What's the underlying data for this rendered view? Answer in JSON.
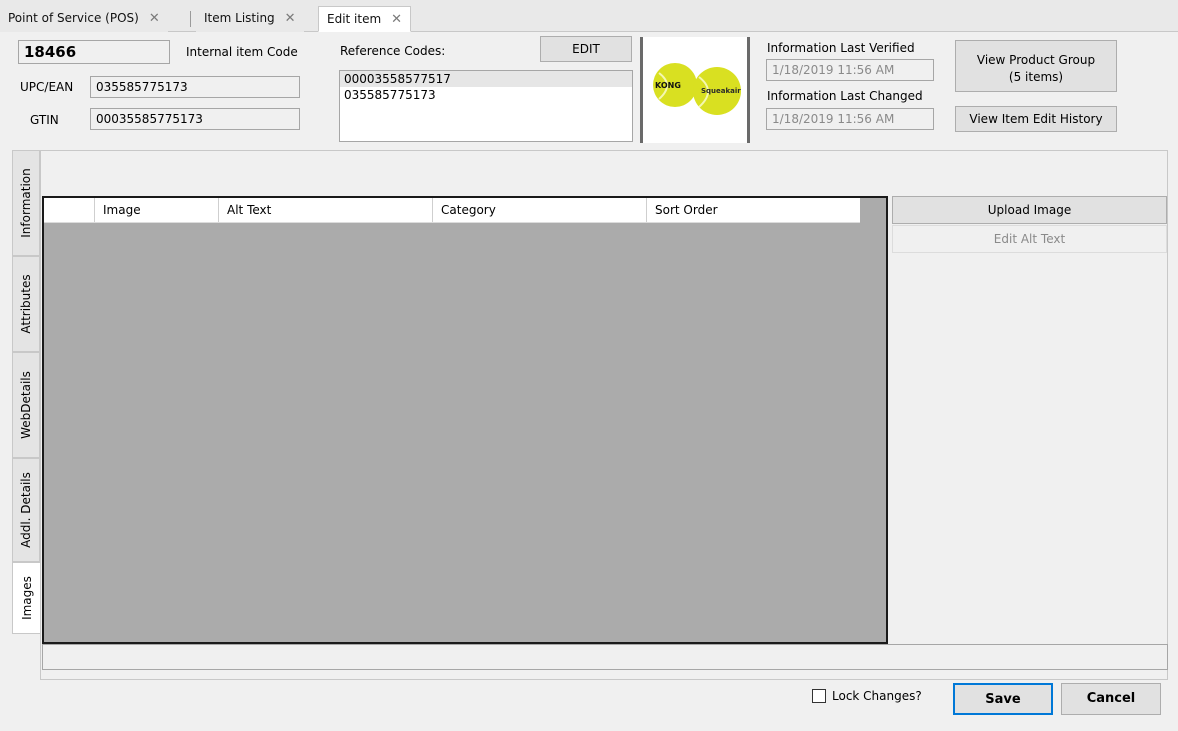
{
  "tabs": [
    {
      "label": "Point of Service (POS)",
      "close": "✕"
    },
    {
      "label": "Item Listing",
      "close": "✕"
    },
    {
      "label": "Edit item",
      "close": "✕"
    }
  ],
  "header": {
    "item_code": "18466",
    "internal_item_code_label": "Internal item Code",
    "upc_label": "UPC/EAN",
    "upc_value": "035585775173",
    "gtin_label": "GTIN",
    "gtin_value": "00035585775173",
    "reference_codes_label": "Reference Codes:",
    "edit_button": "EDIT",
    "reference_codes": [
      "00003558577517",
      "035585775173"
    ],
    "image_logo_text": "KONG",
    "image_logo_text2": "Squeakair",
    "info_last_verified_label": "Information Last Verified",
    "info_last_verified_value": "1/18/2019 11:56 AM",
    "info_last_changed_label": "Information Last Changed",
    "info_last_changed_value": "1/18/2019 11:56 AM",
    "view_product_group_line1": "View Product Group",
    "view_product_group_line2": "(5 items)",
    "view_edit_history": "View Item Edit History"
  },
  "side_tabs": [
    "Information",
    "Attributes",
    "WebDetails",
    "Addl. Details",
    "Images"
  ],
  "active_side_tab": "Images",
  "grid": {
    "columns": [
      "Image",
      "Alt Text",
      "Category",
      "Sort Order"
    ]
  },
  "actions": {
    "upload_image": "Upload Image",
    "edit_alt_text": "Edit Alt Text"
  },
  "footer": {
    "lock_changes": "Lock Changes?",
    "save": "Save",
    "cancel": "Cancel"
  },
  "colors": {
    "grid_background": "#ababab",
    "ball_yellow": "#d9e021",
    "disabled_text": "#8a8a8a"
  }
}
